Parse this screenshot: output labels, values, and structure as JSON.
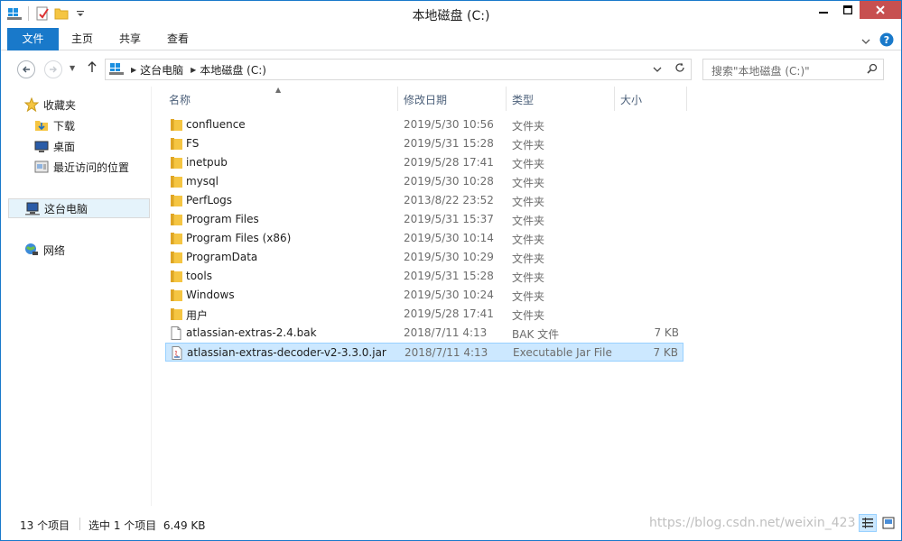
{
  "window": {
    "title": "本地磁盘 (C:)"
  },
  "ribbon": {
    "tabs": [
      {
        "label": "文件"
      },
      {
        "label": "主页"
      },
      {
        "label": "共享"
      },
      {
        "label": "查看"
      }
    ]
  },
  "address": {
    "crumbs": [
      "这台电脑",
      "本地磁盘 (C:)"
    ],
    "search_placeholder": "搜索\"本地磁盘 (C:)\""
  },
  "navpane": {
    "favorites": {
      "label": "收藏夹",
      "items": [
        {
          "label": "下载"
        },
        {
          "label": "桌面"
        },
        {
          "label": "最近访问的位置"
        }
      ]
    },
    "this_pc": {
      "label": "这台电脑"
    },
    "network": {
      "label": "网络"
    }
  },
  "filelist": {
    "columns": {
      "name": "名称",
      "date": "修改日期",
      "type": "类型",
      "size": "大小"
    },
    "rows": [
      {
        "name": "confluence",
        "date": "2019/5/30 10:56",
        "type": "文件夹",
        "size": "",
        "icon": "folder-icon"
      },
      {
        "name": "FS",
        "date": "2019/5/31 15:28",
        "type": "文件夹",
        "size": "",
        "icon": "folder-icon"
      },
      {
        "name": "inetpub",
        "date": "2019/5/28 17:41",
        "type": "文件夹",
        "size": "",
        "icon": "folder-icon"
      },
      {
        "name": "mysql",
        "date": "2019/5/30 10:28",
        "type": "文件夹",
        "size": "",
        "icon": "folder-icon"
      },
      {
        "name": "PerfLogs",
        "date": "2013/8/22 23:52",
        "type": "文件夹",
        "size": "",
        "icon": "folder-icon"
      },
      {
        "name": "Program Files",
        "date": "2019/5/31 15:37",
        "type": "文件夹",
        "size": "",
        "icon": "folder-icon"
      },
      {
        "name": "Program Files (x86)",
        "date": "2019/5/30 10:14",
        "type": "文件夹",
        "size": "",
        "icon": "folder-icon"
      },
      {
        "name": "ProgramData",
        "date": "2019/5/30 10:29",
        "type": "文件夹",
        "size": "",
        "icon": "folder-icon"
      },
      {
        "name": "tools",
        "date": "2019/5/31 15:28",
        "type": "文件夹",
        "size": "",
        "icon": "folder-icon"
      },
      {
        "name": "Windows",
        "date": "2019/5/30 10:24",
        "type": "文件夹",
        "size": "",
        "icon": "folder-icon"
      },
      {
        "name": "用户",
        "date": "2019/5/28 17:41",
        "type": "文件夹",
        "size": "",
        "icon": "folder-icon"
      },
      {
        "name": "atlassian-extras-2.4.bak",
        "date": "2018/7/11 4:13",
        "type": "BAK 文件",
        "size": "7 KB",
        "icon": "file-icon"
      },
      {
        "name": "atlassian-extras-decoder-v2-3.3.0.jar",
        "date": "2018/7/11 4:13",
        "type": "Executable Jar File",
        "size": "7 KB",
        "icon": "jar-icon"
      }
    ]
  },
  "status": {
    "count": "13 个项目",
    "selection": "选中 1 个项目  6.49 KB",
    "watermark": "https://blog.csdn.net/weixin_423"
  },
  "colors": {
    "accent": "#1979ca",
    "selected_row": "#cce8ff",
    "close_button": "#c75050",
    "folder": "#f5c542"
  }
}
